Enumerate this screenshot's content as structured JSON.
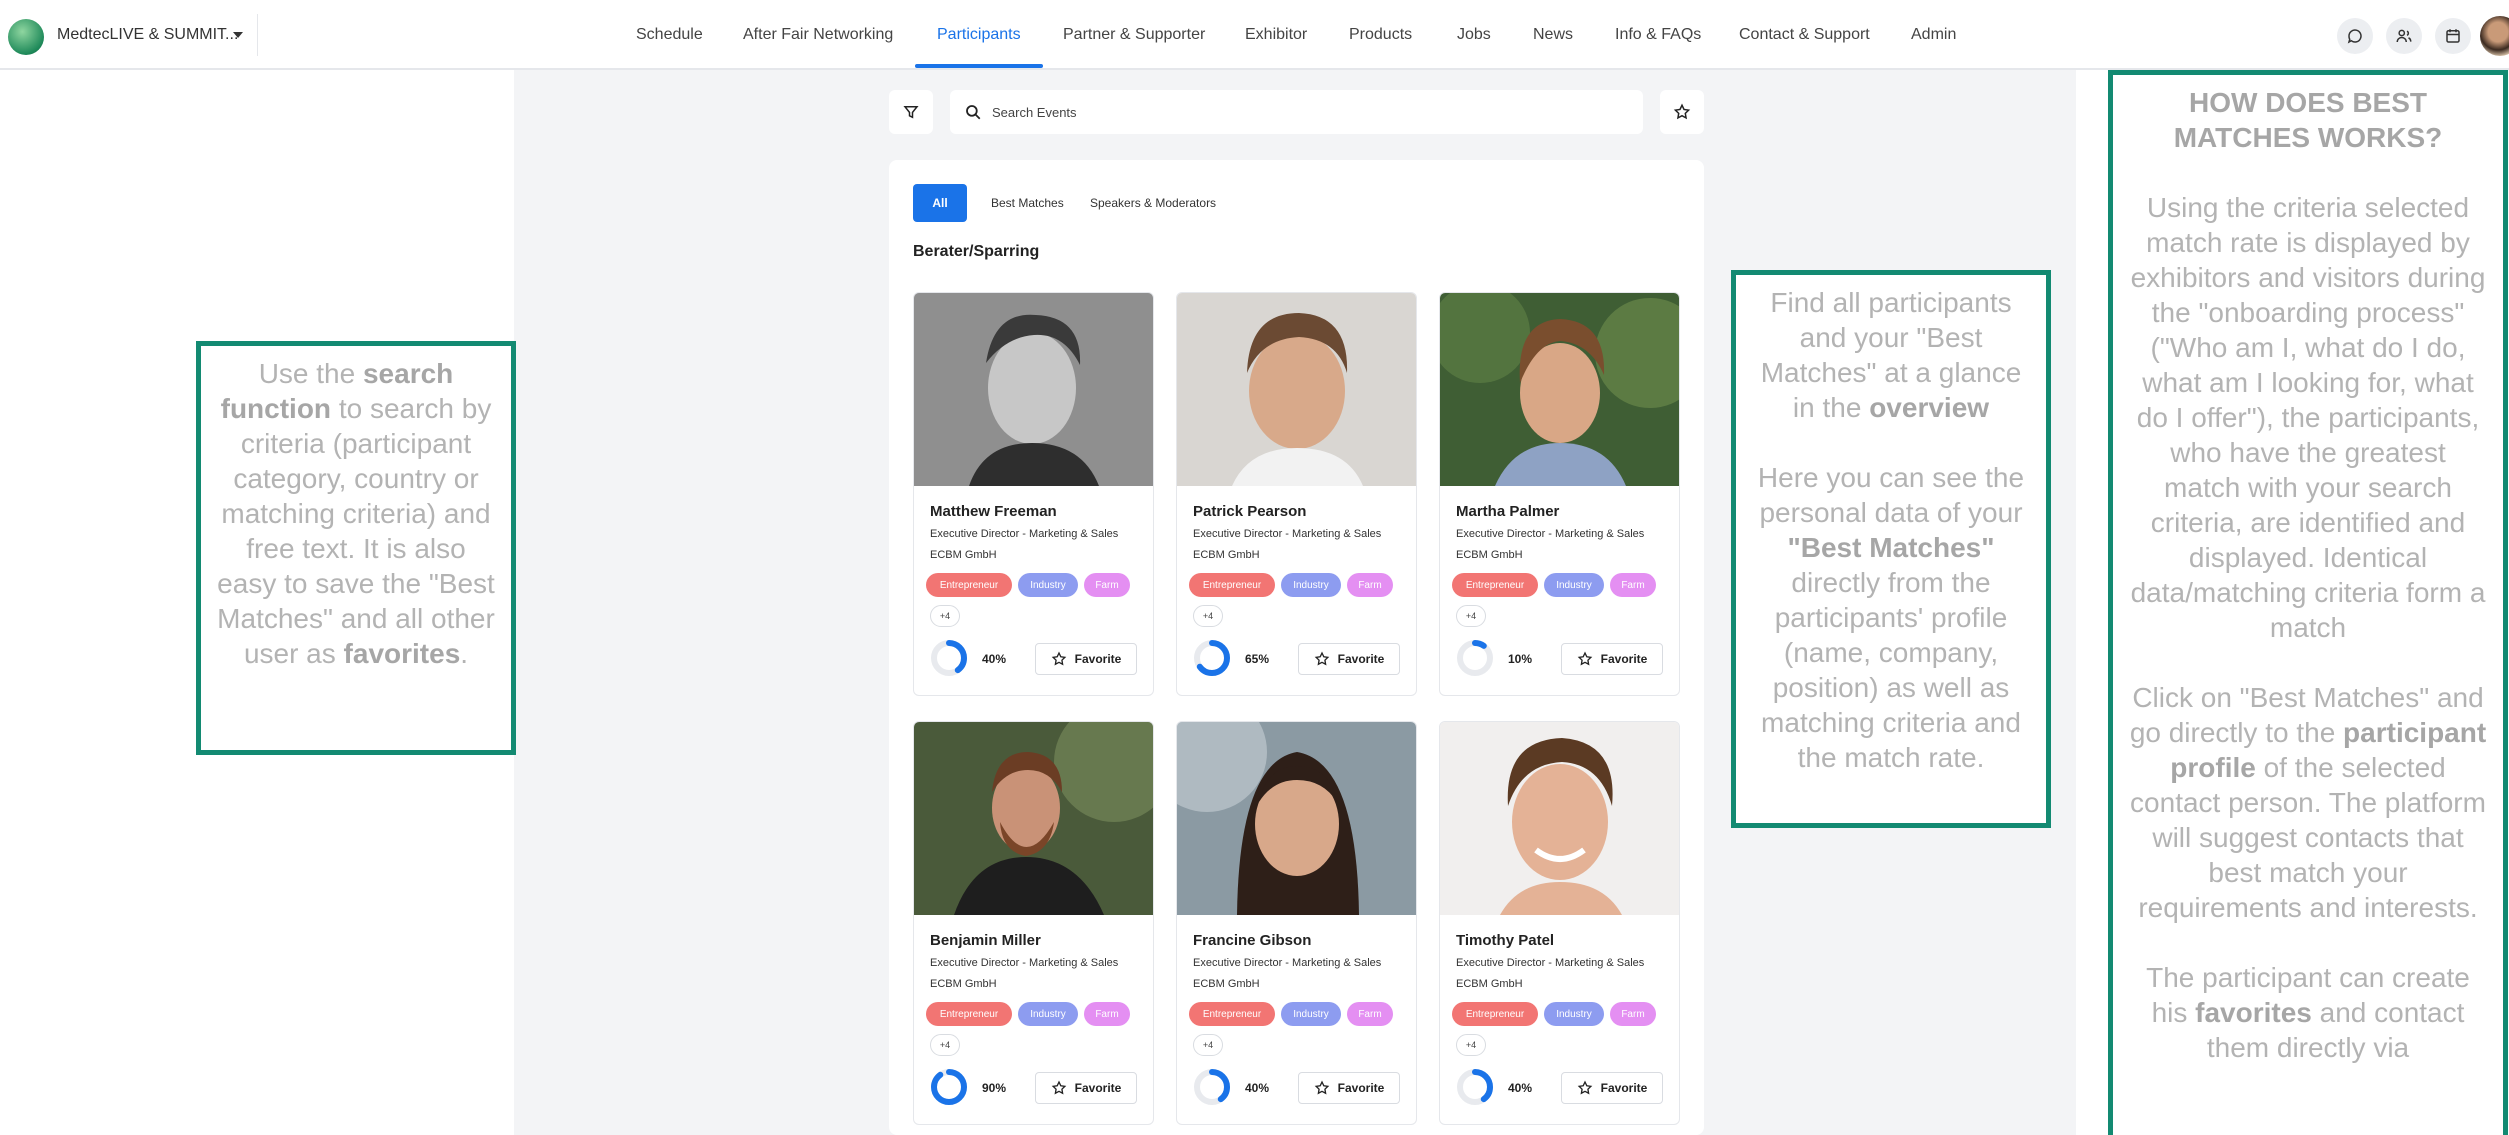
{
  "header": {
    "event_name": "MedtecLIVE & SUMMIT...",
    "nav": [
      {
        "label": "Schedule"
      },
      {
        "label": "After Fair Networking"
      },
      {
        "label": "Participants",
        "active": true
      },
      {
        "label": "Partner & Supporter"
      },
      {
        "label": "Exhibitor"
      },
      {
        "label": "Products"
      },
      {
        "label": "Jobs"
      },
      {
        "label": "News"
      },
      {
        "label": "Info & FAQs"
      },
      {
        "label": "Contact & Support"
      },
      {
        "label": "Admin"
      }
    ],
    "icons": [
      "chat-icon",
      "people-icon",
      "calendar-icon",
      "user-avatar"
    ],
    "accent_color": "#1a73e8"
  },
  "search": {
    "placeholder": "Search Events",
    "value": ""
  },
  "tabs": [
    {
      "label": "All",
      "active": true
    },
    {
      "label": "Best Matches"
    },
    {
      "label": "Speakers & Moderators"
    }
  ],
  "section_title": "Berater/Sparring",
  "participants": [
    {
      "name": "Matthew Freeman",
      "position": "Executive Director - Marketing & Sales",
      "company": "ECBM GmbH",
      "tags": [
        "Entrepreneur",
        "Industry",
        "Farm"
      ],
      "more": "+4",
      "match": 0.4,
      "match_label": "40%",
      "favorite_label": "Favorite"
    },
    {
      "name": "Patrick Pearson",
      "position": "Executive Director - Marketing & Sales",
      "company": "ECBM GmbH",
      "tags": [
        "Entrepreneur",
        "Industry",
        "Farm"
      ],
      "more": "+4",
      "match": 0.65,
      "match_label": "65%",
      "favorite_label": "Favorite"
    },
    {
      "name": "Martha Palmer",
      "position": "Executive Director - Marketing & Sales",
      "company": "ECBM GmbH",
      "tags": [
        "Entrepreneur",
        "Industry",
        "Farm"
      ],
      "more": "+4",
      "match": 0.1,
      "match_label": "10%",
      "favorite_label": "Favorite"
    },
    {
      "name": "Benjamin Miller",
      "position": "Executive Director - Marketing & Sales",
      "company": "ECBM GmbH",
      "tags": [
        "Entrepreneur",
        "Industry",
        "Farm"
      ],
      "more": "+4",
      "match": 0.9,
      "match_label": "90%",
      "favorite_label": "Favorite"
    },
    {
      "name": "Francine Gibson",
      "position": "Executive Director - Marketing & Sales",
      "company": "ECBM GmbH",
      "tags": [
        "Entrepreneur",
        "Industry",
        "Farm"
      ],
      "more": "+4",
      "match": 0.4,
      "match_label": "40%",
      "favorite_label": "Favorite"
    },
    {
      "name": "Timothy Patel",
      "position": "Executive Director - Marketing & Sales",
      "company": "ECBM GmbH",
      "tags": [
        "Entrepreneur",
        "Industry",
        "Farm"
      ],
      "more": "+4",
      "match": 0.4,
      "match_label": "40%",
      "favorite_label": "Favorite"
    }
  ],
  "tag_colors": [
    "#f27573",
    "#8d9cf0",
    "#e48ff2"
  ],
  "annotations": {
    "left": {
      "t1": "Use the ",
      "b1": "search function",
      "t2": " to search by criteria (participant category, country or matching criteria) and free text. It is also easy to save the \"Best Matches\" and all other user as ",
      "b2": "favorites",
      "t3": "."
    },
    "middle": {
      "t1": "Find all  participants and your \"Best Matches\" at a glance in the ",
      "b1": "overview",
      "t2": "Here you can see the personal data of your ",
      "b2": "\"Best Matches\"",
      "t3": " directly from the participants' profile (name, company, position) as well as matching criteria and the match rate."
    },
    "right": {
      "heading": "HOW DOES BEST MATCHES WORKS?",
      "p1": "Using the criteria selected match rate is displayed by exhibitors and visitors during the \"onboarding process\" (\"Who am I, what do I do, what am I looking for, what do I offer\"), the participants, who have the greatest match with your search criteria, are identified and displayed. Identical data/matching criteria form a match",
      "p2a": "Click on \"Best Matches\" and go directly to the ",
      "p2b": "participant profile",
      "p2c": " of the selected contact person. The platform will suggest contacts that best match your requirements and interests.",
      "p3a": "The participant can create his ",
      "p3b": "favorites",
      "p3c": " and contact them directly via"
    },
    "border_color": "#138a72"
  }
}
